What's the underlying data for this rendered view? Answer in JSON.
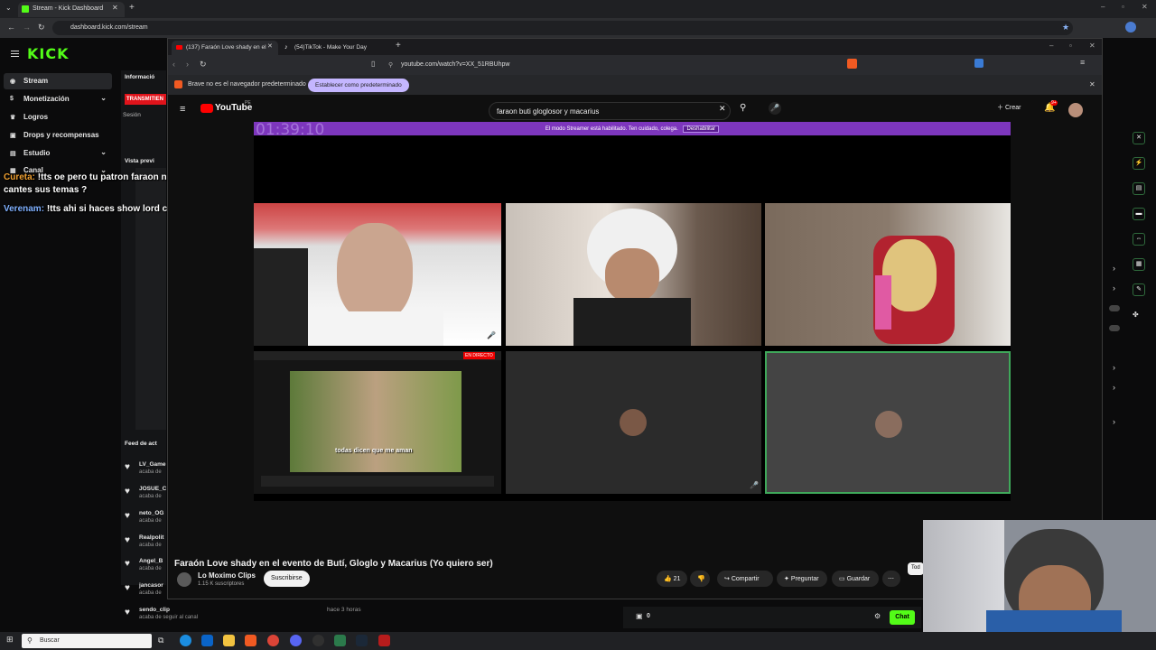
{
  "chrome": {
    "tab_title": "Stream - Kick Dashboard",
    "new_tab": "+",
    "url": "dashboard.kick.com/stream"
  },
  "kick": {
    "logo": "KICK",
    "nav": [
      {
        "label": "Stream",
        "icon": "broadcast-icon"
      },
      {
        "label": "Monetización",
        "icon": "dollar-icon"
      },
      {
        "label": "Logros",
        "icon": "trophy-icon"
      },
      {
        "label": "Drops y recompensas",
        "icon": "gift-icon"
      },
      {
        "label": "Estudio",
        "icon": "studio-icon"
      },
      {
        "label": "Canal",
        "icon": "channel-icon"
      }
    ],
    "info_label": "Informació",
    "live_button": "TRANSMITIEN",
    "session_label": "Sesión",
    "preview_label": "Vista previ",
    "feed_label": "Feed de act",
    "feed": [
      {
        "name": "LV_Game",
        "sub": "acaba de",
        "time": ""
      },
      {
        "name": "JOSUE_C",
        "sub": "acaba de",
        "time": ""
      },
      {
        "name": "neto_OG",
        "sub": "acaba de",
        "time": ""
      },
      {
        "name": "Realpolit",
        "sub": "acaba de",
        "time": ""
      },
      {
        "name": "Angel_B",
        "sub": "acaba de",
        "time": ""
      },
      {
        "name": "jancasor",
        "sub": "acaba de",
        "time": ""
      },
      {
        "name": "sendo_clip",
        "sub": "acaba de seguir al canal",
        "time": "hace 3 horas"
      }
    ],
    "viewer_count": "0",
    "chat_button": "Chat"
  },
  "overlay_chat": [
    {
      "user": "Cureta:",
      "message": "!tts oe pero tu patron faraon no te llama para que le",
      "message2": "cantes sus temas ?"
    },
    {
      "user": "Verenam:",
      "message": "!tts ahi si haces show lord cpp"
    }
  ],
  "brave": {
    "tabs": [
      {
        "title": "(137) Faraón Love shady en el",
        "active": true
      },
      {
        "title": "(54)TikTok - Make Your Day",
        "active": false
      }
    ],
    "url": "youtube.com/watch?v=XX_51RBUhpw",
    "default_browser_text": "Brave no es el navegador predeterminado",
    "default_browser_button": "Establecer como predeterminado"
  },
  "youtube": {
    "logo": "YouTube",
    "country": "PE",
    "search_query": "faraon buti gloglosor y macarius",
    "create_label": "Crear",
    "notif_badge": "9+",
    "streamer_mode_text": "El modo Streamer está habilitado. Ten cuidado, colega.",
    "streamer_mode_button": "Deshabilitar",
    "timer": "01:39:10",
    "inner_live_badge": "EN DIRECTO",
    "inner_caption": "todas dicen que me aman",
    "video_title": "Faraón Love shady en el evento de Butí, Gloglo y Macarius (Yo quiero ser)",
    "channel_name": "Lo Moximo Clips",
    "subscribers": "1.15 K suscriptores",
    "subscribe": "Suscribirse",
    "likes": "21",
    "share": "Compartir",
    "ask": "Preguntar",
    "save": "Guardar",
    "more": "⋯",
    "all_chip": "Tod"
  },
  "taskbar": {
    "search_placeholder": "Buscar"
  },
  "colors": {
    "kick_green": "#53fc18",
    "streamer_purple": "#7d36bd",
    "live_red": "#e0131b"
  }
}
